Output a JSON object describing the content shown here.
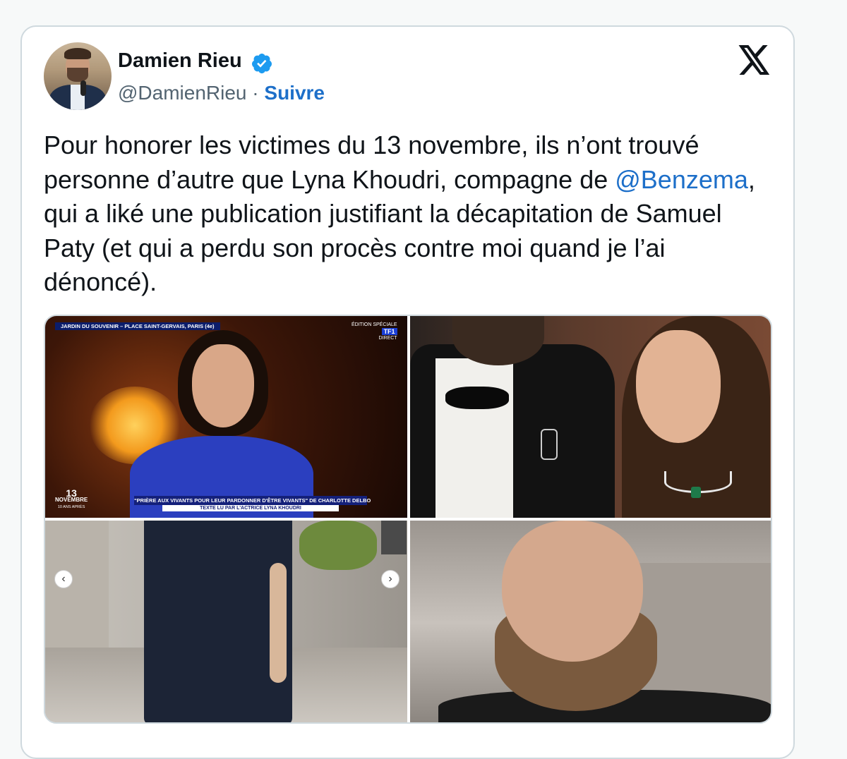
{
  "author": {
    "name": "Damien Rieu",
    "handle": "@DamienRieu",
    "separator": "·",
    "follow_label": "Suivre"
  },
  "icons": {
    "verified": "verified-badge-icon",
    "platform": "x-logo-icon"
  },
  "tweet": {
    "text_part1": "Pour honorer les victimes du 13 novembre, ils n’ont trouvé personne d’autre que Lyna Khoudri, compagne de ",
    "mention": "@Benzema",
    "text_part2": ", qui a liké une publication justifiant la décapitation de Samuel Paty (et qui a perdu son procès contre moi quand je l’ai dénoncé)."
  },
  "media": {
    "image1": {
      "location_banner": "JARDIN DU SOUVENIR – PLACE SAINT-GERVAIS, PARIS (4e)",
      "channel_top": "ÉDITION SPÉCIALE",
      "channel_name": "TF1",
      "channel_live": "DIRECT",
      "caption_line1": "\"PRIÈRE AUX VIVANTS POUR LEUR PARDONNER D'ÊTRE VIVANTS\" DE CHARLOTTE DELBO",
      "caption_line2": "TEXTE LU PAR L'ACTRICE LYNA KHOUDRI",
      "logo_number": "13",
      "logo_word": "NOVEMBRE",
      "logo_sub": "10 ANS APRÈS"
    },
    "image3": {
      "prev_glyph": "‹",
      "next_glyph": "›"
    }
  },
  "colors": {
    "link": "#1d6fc9",
    "verified": "#1d9bf0",
    "text": "#0f1419",
    "secondary": "#536471"
  }
}
